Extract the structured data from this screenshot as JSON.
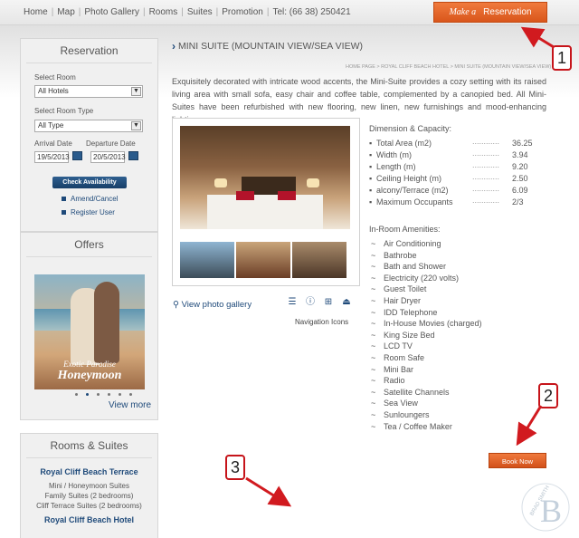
{
  "nav": {
    "items": [
      "Home",
      "Map",
      "Photo Gallery",
      "Rooms",
      "Suites",
      "Promotion",
      "Tel: (66 38) 250421"
    ],
    "reserve_make": "Make a",
    "reserve_label": "Reservation"
  },
  "reservation": {
    "title": "Reservation",
    "select_room_label": "Select Room",
    "select_room_value": "All Hotels",
    "room_type_label": "Select Room Type",
    "room_type_value": "All Type",
    "arrival_label": "Arrival Date",
    "arrival_value": "19/5/2013",
    "departure_label": "Departure Date",
    "departure_value": "20/5/2013",
    "check_button": "Check Availability",
    "links": [
      "Amend/Cancel",
      "Register User"
    ]
  },
  "offers": {
    "title": "Offers",
    "caption_small": "Exotic Paradise",
    "caption_big": "Honeymoon",
    "view_more": "View more"
  },
  "rooms_suites": {
    "title": "Rooms & Suites",
    "group1": "Royal Cliff Beach Terrace",
    "subs": [
      "Mini / Honeymoon Suites",
      "Family Suites (2 bedrooms)",
      "Cliff Terrace Suites (2 bedrooms)"
    ],
    "group2": "Royal Cliff Beach Hotel"
  },
  "main": {
    "title": "MINI SUITE (MOUNTAIN VIEW/SEA VIEW)",
    "breadcrumb": "HOME PAGE  >  ROYAL CLIFF BEACH HOTEL  >  MINI SUITE (MOUNTAIN VIEW/SEA VIEW)",
    "description": "Exquisitely decorated with intricate wood accents, the Mini-Suite provides a cozy setting with its raised living area with small sofa, easy chair and coffee table, complemented by a canopied bed. All Mini-Suites have been refurbished with new flooring, new linen, new furnishings and mood-enhancing lighting.",
    "gallery_link": "View photo gallery",
    "nav_icons_caption": "Navigation Icons",
    "dim_title": "Dimension & Capacity:",
    "dimensions": [
      {
        "name": "Total Area (m2)",
        "value": "36.25"
      },
      {
        "name": "Width (m)",
        "value": "3.94"
      },
      {
        "name": "Length (m)",
        "value": "9.20"
      },
      {
        "name": "Ceiling Height (m)",
        "value": "2.50"
      },
      {
        "name": "alcony/Terrace (m2)",
        "value": "6.09"
      },
      {
        "name": "Maximum Occupants",
        "value": "2/3"
      }
    ],
    "dots": "............",
    "amen_title": "In-Room Amenities:",
    "amenities": [
      "Air Conditioning",
      "Bathrobe",
      "Bath and Shower",
      "Electricity (220 volts)",
      "Guest Toilet",
      "Hair Dryer",
      "IDD Telephone",
      "In-House Movies (charged)",
      "King Size Bed",
      "LCD TV",
      "Room Safe",
      "Mini Bar",
      "Radio",
      "Satellite Channels",
      "Sea View",
      "Sunloungers",
      "Tea / Coffee Maker"
    ],
    "book_now": "Book Now"
  },
  "annotations": [
    "1",
    "2",
    "3"
  ],
  "accent": "#e5661f",
  "link_color": "#1f4a7a"
}
